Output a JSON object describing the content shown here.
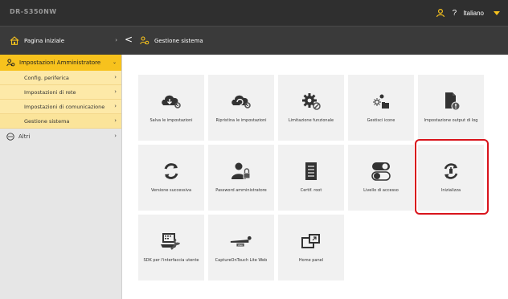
{
  "header": {
    "device_name": "DR-S350NW",
    "help_label": "?",
    "language": "Italiano"
  },
  "breadcrumb": {
    "home_label": "Pagina iniziale",
    "home_chevron": "›",
    "back_label": "<",
    "current_label": "Gestione sistema"
  },
  "sidebar": {
    "header_label": "Impostazioni Amministratore",
    "header_caret": "⌄",
    "items": [
      {
        "label": "Config. periferica"
      },
      {
        "label": "Impostazioni di rete"
      },
      {
        "label": "Impostazioni di comunicazione"
      },
      {
        "label": "Gestione sistema"
      }
    ],
    "item_chevron": "›",
    "other_label": "Altri"
  },
  "tiles": [
    {
      "label": "Salva le impostazioni",
      "icon": "cloud-save-icon"
    },
    {
      "label": "Ripristina le impostazioni",
      "icon": "cloud-restore-icon"
    },
    {
      "label": "Limitazione funzionale",
      "icon": "gear-restrict-icon"
    },
    {
      "label": "Gestisci icone",
      "icon": "manage-icons-icon"
    },
    {
      "label": "Impostazione output di log",
      "icon": "log-output-icon"
    },
    {
      "label": "Versione successiva",
      "icon": "update-icon"
    },
    {
      "label": "Password amministratore",
      "icon": "admin-password-icon"
    },
    {
      "label": "Certif. root",
      "icon": "certificate-icon"
    },
    {
      "label": "Livello di accesso",
      "icon": "toggle-access-icon"
    },
    {
      "label": "Inizializza",
      "icon": "initialize-icon"
    },
    {
      "label": "SDK per l'interfaccia utente",
      "icon": "sdk-icon"
    },
    {
      "label": "CaptureOnTouch Lite Web",
      "icon": "capture-web-icon"
    },
    {
      "label": "Home panel",
      "icon": "home-panel-icon"
    }
  ],
  "colors": {
    "accent": "#f7c21d",
    "highlight": "#d9141c",
    "topbar": "#2f2f2f"
  }
}
